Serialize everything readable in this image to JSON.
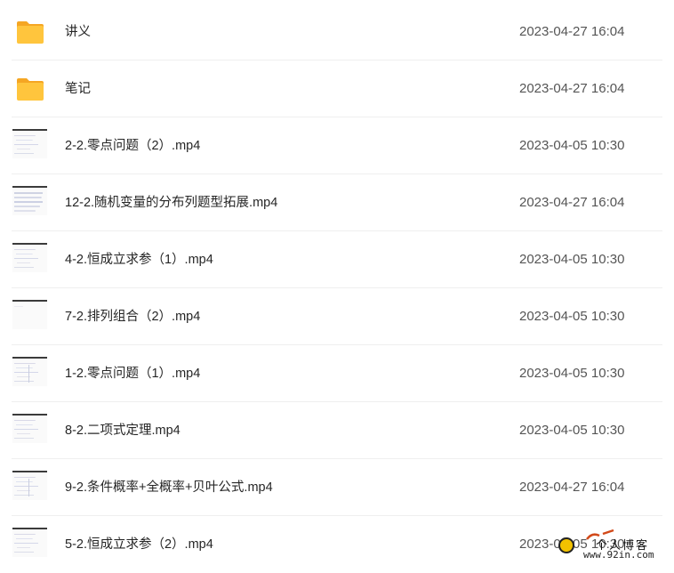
{
  "files": [
    {
      "name": "讲义",
      "date": "2023-04-27 16:04",
      "icon": "folder-icon"
    },
    {
      "name": "笔记",
      "date": "2023-04-27 16:04",
      "icon": "folder-icon"
    },
    {
      "name": "2-2.零点问题（2）.mp4",
      "date": "2023-04-05 10:30",
      "icon": "video-thumbnail-icon"
    },
    {
      "name": "12-2.随机变量的分布列题型拓展.mp4",
      "date": "2023-04-27 16:04",
      "icon": "video-thumbnail-icon"
    },
    {
      "name": "4-2.恒成立求参（1）.mp4",
      "date": "2023-04-05 10:30",
      "icon": "video-thumbnail-icon"
    },
    {
      "name": "7-2.排列组合（2）.mp4",
      "date": "2023-04-05 10:30",
      "icon": "video-thumbnail-icon"
    },
    {
      "name": "1-2.零点问题（1）.mp4",
      "date": "2023-04-05 10:30",
      "icon": "video-thumbnail-icon"
    },
    {
      "name": "8-2.二项式定理.mp4",
      "date": "2023-04-05 10:30",
      "icon": "video-thumbnail-icon"
    },
    {
      "name": "9-2.条件概率+全概率+贝叶公式.mp4",
      "date": "2023-04-27 16:04",
      "icon": "video-thumbnail-icon"
    },
    {
      "name": "5-2.恒成立求参（2）.mp4",
      "date": "2023-04-05 10:30",
      "icon": "video-thumbnail-icon"
    }
  ],
  "watermark": {
    "title": "个人博客",
    "url": "www.92in.com"
  },
  "colors": {
    "folder_yellow": "#FFC53D",
    "folder_yellow_dark": "#F5A623",
    "row_divider": "#EFEFEF",
    "date_text": "#555555"
  }
}
